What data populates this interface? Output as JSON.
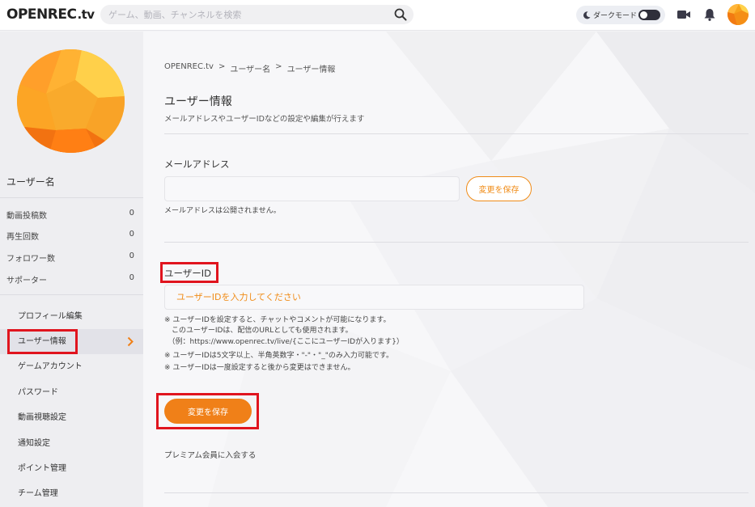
{
  "header": {
    "logo_main": "OPENREC",
    "logo_suffix": ".tv",
    "search_placeholder": "ゲーム、動画、チャンネルを検索",
    "dark_mode_label": "ダークモード"
  },
  "sidebar": {
    "username": "ユーザー名",
    "stats": [
      {
        "label": "動画投稿数",
        "value": "0"
      },
      {
        "label": "再生回数",
        "value": "0"
      },
      {
        "label": "フォロワー数",
        "value": "0"
      },
      {
        "label": "サポーター",
        "value": "0"
      }
    ],
    "menu": [
      {
        "label": "プロフィール編集"
      },
      {
        "label": "ユーザー情報"
      },
      {
        "label": "ゲームアカウント"
      },
      {
        "label": "パスワード"
      },
      {
        "label": "動画視聴設定"
      },
      {
        "label": "通知設定"
      },
      {
        "label": "ポイント管理"
      },
      {
        "label": "チーム管理"
      }
    ]
  },
  "main": {
    "breadcrumb": [
      "OPENREC.tv",
      ">",
      "ユーザー名",
      ">",
      "ユーザー情報"
    ],
    "title": "ユーザー情報",
    "description": "メールアドレスやユーザーIDなどの設定や編集が行えます",
    "email": {
      "label": "メールアドレス",
      "value": "",
      "save_label": "変更を保存",
      "note": "メールアドレスは公開されません。"
    },
    "user_id": {
      "label": "ユーザーID",
      "placeholder": "ユーザーIDを入力してください",
      "notes": [
        "※ ユーザーIDを設定すると、チャットやコメントが可能になります。",
        "　このユーザーIDは、配信のURLとしても使用されます。",
        "　（例：https://www.openrec.tv/live/{ここにユーザーIDが入ります}）",
        "※ ユーザーIDは5文字以上、半角英数字・\"-\"・\"_\"のみ入力可能です。",
        "※ ユーザーIDは一度設定すると後から変更はできません。"
      ],
      "save_label": "変更を保存"
    },
    "premium_link": "プレミアム会員に入会する"
  },
  "colors": {
    "accent": "#f08018",
    "highlight_box": "#e0141e"
  }
}
